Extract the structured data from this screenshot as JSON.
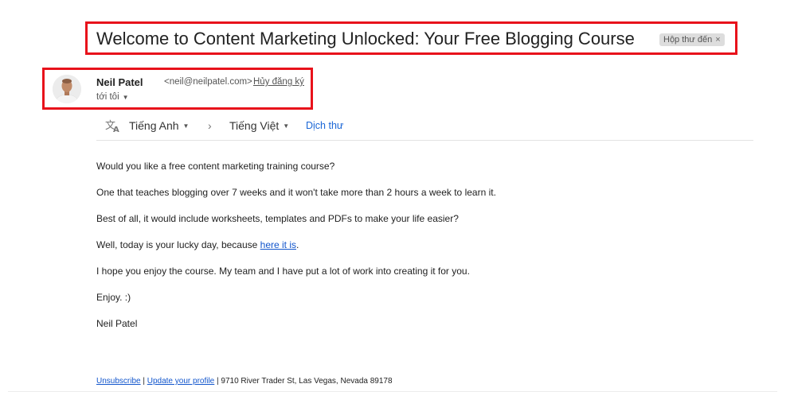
{
  "email": {
    "subject": "Welcome to Content Marketing Unlocked: Your Free Blogging Course",
    "label": "Hộp thư đến",
    "label_close": "×",
    "sender": {
      "name": "Neil Patel",
      "email": "<neil@neilpatel.com>",
      "unsubscribe": "Hủy đăng ký",
      "to": "tới tôi",
      "to_caret": "▼"
    },
    "translate": {
      "icon": "translate-icon",
      "from": "Tiếng Anh",
      "arrow": "›",
      "to": "Tiếng Việt",
      "caret": "▼",
      "action": "Dịch thư"
    },
    "body": {
      "p1": "Would you like a free content marketing training course?",
      "p2": "One that teaches blogging over 7 weeks and it won't take more than 2 hours a week to learn it.",
      "p3": "Best of all, it would include worksheets, templates and PDFs to make your life easier?",
      "p4_before": "Well, today is your lucky day, because ",
      "p4_link": "here it is",
      "p4_after": ".",
      "p5": "I hope you enjoy the course. My team and I have put a lot of work into creating it for you.",
      "p6": "Enjoy. :)",
      "p7": "Neil Patel"
    },
    "footer": {
      "unsubscribe": "Unsubscribe",
      "sep1": " | ",
      "update_profile": "Update your profile",
      "sep2": " | ",
      "address": "9710 River Trader St, Las Vegas, Nevada 89178"
    }
  },
  "colors": {
    "highlight": "#e8121b",
    "link": "#1155cc",
    "translate_link": "#1a66d6"
  }
}
